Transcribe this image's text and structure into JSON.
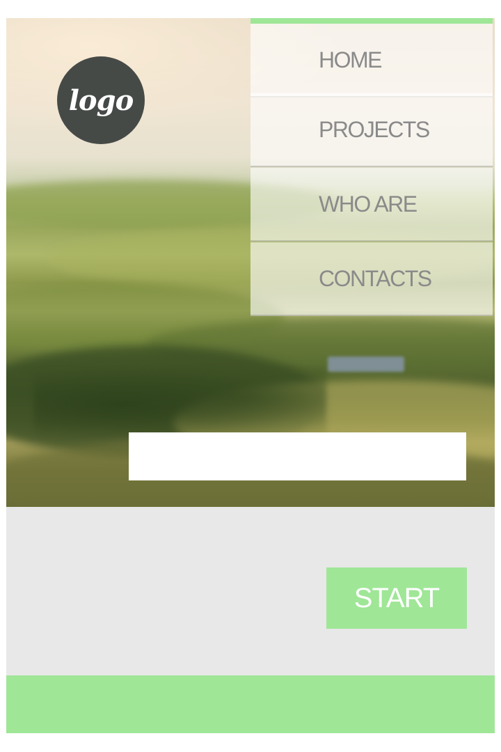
{
  "brand": {
    "logo_text": "logo",
    "accent_color": "#9fe697",
    "logo_color": "#464a47"
  },
  "nav": {
    "items": [
      {
        "label": "HOME"
      },
      {
        "label": "PROJECTS"
      },
      {
        "label": "WHO ARE"
      },
      {
        "label": "CONTACTS"
      }
    ]
  },
  "form": {
    "input_value": "",
    "input_placeholder": ""
  },
  "panel": {
    "start_label": "START",
    "background_color": "#e8e8e8"
  }
}
